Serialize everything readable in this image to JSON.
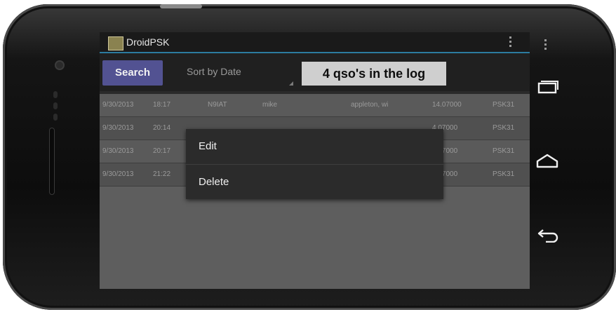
{
  "app": {
    "title": "DroidPSK"
  },
  "toolbar": {
    "search_label": "Search",
    "sort_label": "Sort by Date",
    "count_text": "4 qso's in the log"
  },
  "log": {
    "rows": [
      {
        "date": "9/30/2013",
        "time": "18:17",
        "call": "N9IAT",
        "name": "mike",
        "location": "appleton, wi",
        "freq": "14.07000",
        "mode": "PSK31"
      },
      {
        "date": "9/30/2013",
        "time": "20:14",
        "call": "",
        "name": "",
        "location": "",
        "freq": "4.07000",
        "mode": "PSK31"
      },
      {
        "date": "9/30/2013",
        "time": "20:17",
        "call": "",
        "name": "",
        "location": "",
        "freq": "4.07000",
        "mode": "PSK31"
      },
      {
        "date": "9/30/2013",
        "time": "21:22",
        "call": "",
        "name": "",
        "location": "",
        "freq": "1.07000",
        "mode": "PSK31"
      }
    ]
  },
  "context_menu": {
    "items": [
      {
        "label": "Edit"
      },
      {
        "label": "Delete"
      }
    ]
  },
  "colors": {
    "search_button": "#525292",
    "divider": "#2c7ca0",
    "count_box": "#cfcfcf"
  },
  "icons": {
    "app": "droidpsk-app-icon",
    "overflow": "overflow-menu-icon",
    "recents": "recent-apps-icon",
    "home": "home-icon",
    "back": "back-icon"
  }
}
